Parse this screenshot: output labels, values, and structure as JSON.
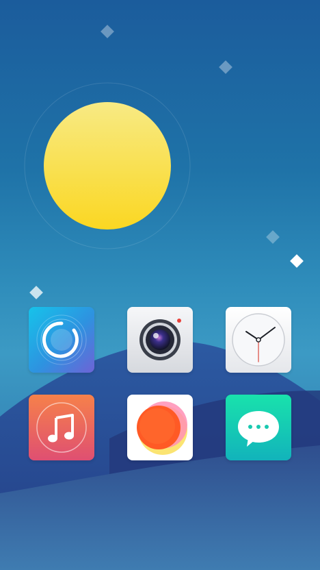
{
  "screen": {
    "type": "launcher-home",
    "wallpaper": {
      "theme": "sun-over-hills",
      "colors": {
        "sky_top": "#1b5c9c",
        "sky_mid": "#3c9ac4",
        "sun_top": "#f9e97a",
        "sun_bottom": "#fad92a",
        "hill_back": "#2b4f97",
        "hill_front": "#2a4588",
        "bottom": "#3a6fa6"
      }
    }
  },
  "apps": [
    {
      "id": "app-1",
      "icon": "browser-ring-icon",
      "colors": [
        "#1ab6e8",
        "#6b67d6"
      ]
    },
    {
      "id": "app-2",
      "icon": "camera-icon",
      "colors": [
        "#f4f5f7",
        "#d9dbe0"
      ]
    },
    {
      "id": "app-3",
      "icon": "clock-icon",
      "colors": [
        "#ffffff",
        "#e6e8ec"
      ]
    },
    {
      "id": "app-4",
      "icon": "music-note-icon",
      "colors": [
        "#f47a4c",
        "#e0506f"
      ]
    },
    {
      "id": "app-5",
      "icon": "photos-circle-icon",
      "colors": [
        "#ffffff",
        "#ff5a2c"
      ]
    },
    {
      "id": "app-6",
      "icon": "message-bubble-icon",
      "colors": [
        "#1ae0b0",
        "#12b5b9"
      ]
    }
  ]
}
